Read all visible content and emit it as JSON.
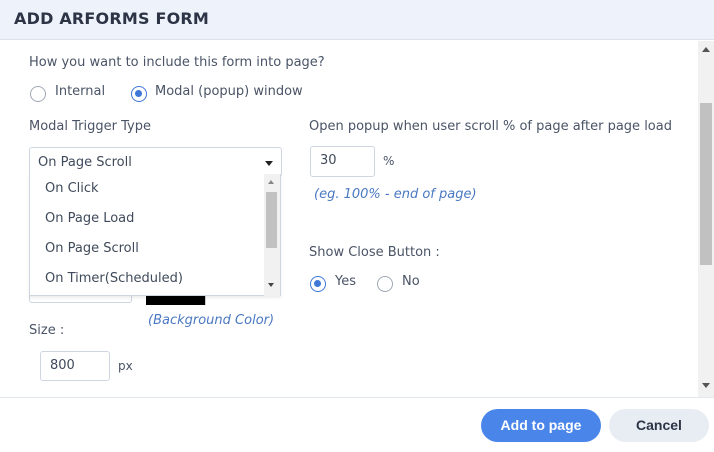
{
  "header": {
    "title": "ADD ARFORMS FORM"
  },
  "include": {
    "question": "How you want to include this form into page?",
    "options": [
      {
        "label": "Internal",
        "checked": false
      },
      {
        "label": "Modal (popup) window",
        "checked": true
      }
    ]
  },
  "trigger": {
    "label": "Modal Trigger Type",
    "selected": "On Page Scroll",
    "options": [
      "On Click",
      "On Page Load",
      "On Page Scroll",
      "On Timer(Scheduled)"
    ]
  },
  "scroll_percent": {
    "label": "Open popup when user scroll % of page after page load",
    "value": "30",
    "unit": "%",
    "hint": "(eg. 100% - end of page)"
  },
  "close_button": {
    "label": "Show Close Button :",
    "options": [
      {
        "label": "Yes",
        "checked": true
      },
      {
        "label": "No",
        "checked": false
      }
    ]
  },
  "background": {
    "hint": "(Background Color)",
    "color": "#000000"
  },
  "size": {
    "label": "Size :",
    "width_value": "800",
    "unit": "px"
  },
  "footer": {
    "primary_label": "Add to page",
    "secondary_label": "Cancel"
  },
  "colors": {
    "accent": "#4a86ea",
    "hint": "#4a78c2",
    "header_bg": "#eef2fb"
  }
}
